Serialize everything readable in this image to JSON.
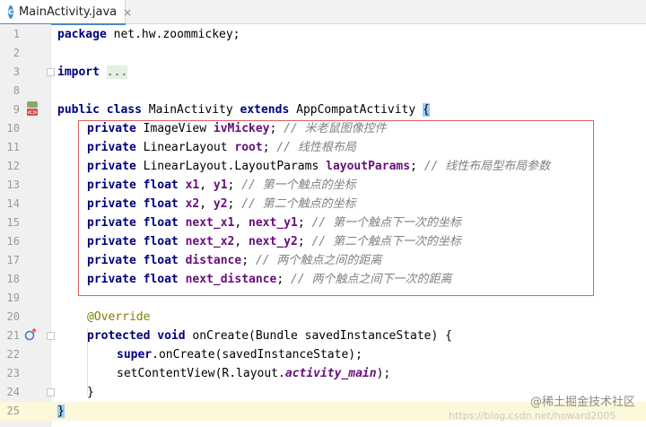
{
  "tab": {
    "icon_letter": "c",
    "label": "MainActivity.java",
    "close": "×"
  },
  "lines": [
    {
      "n": "1"
    },
    {
      "n": "2"
    },
    {
      "n": "3"
    },
    {
      "n": "8"
    },
    {
      "n": "9"
    },
    {
      "n": "10"
    },
    {
      "n": "11"
    },
    {
      "n": "12"
    },
    {
      "n": "13"
    },
    {
      "n": "14"
    },
    {
      "n": "15"
    },
    {
      "n": "16"
    },
    {
      "n": "17"
    },
    {
      "n": "18"
    },
    {
      "n": "19"
    },
    {
      "n": "20"
    },
    {
      "n": "21"
    },
    {
      "n": "22"
    },
    {
      "n": "23"
    },
    {
      "n": "24"
    },
    {
      "n": "25"
    }
  ],
  "code": {
    "l1_kw": "package",
    "l1_rest": " net.hw.zoommickey;",
    "l3_kw": "import",
    "l3_dots": "...",
    "l9_kw1": "public class",
    "l9_name": " MainActivity ",
    "l9_kw2": "extends",
    "l9_rest": " AppCompatActivity ",
    "l9_brace": "{",
    "l10_kw": "private",
    "l10_type": " ImageView ",
    "l10_field": "ivMickey",
    "l10_semi": "; ",
    "l10_cmt": "// 米老鼠图像控件",
    "l11_kw": "private",
    "l11_type": " LinearLayout ",
    "l11_field": "root",
    "l11_semi": "; ",
    "l11_cmt": "// 线性根布局",
    "l12_kw": "private",
    "l12_type": " LinearLayout.LayoutParams ",
    "l12_field": "layoutParams",
    "l12_semi": "; ",
    "l12_cmt": "// 线性布局型布局参数",
    "l13_kw": "private float",
    "l13_f1": " x1",
    "l13_c": ", ",
    "l13_f2": "y1",
    "l13_semi": "; ",
    "l13_cmt": "// 第一个触点的坐标",
    "l14_kw": "private float",
    "l14_f1": " x2",
    "l14_c": ", ",
    "l14_f2": "y2",
    "l14_semi": "; ",
    "l14_cmt": "// 第二个触点的坐标",
    "l15_kw": "private float",
    "l15_f1": " next_x1",
    "l15_c": ", ",
    "l15_f2": "next_y1",
    "l15_semi": "; ",
    "l15_cmt": "// 第一个触点下一次的坐标",
    "l16_kw": "private float",
    "l16_f1": " next_x2",
    "l16_c": ", ",
    "l16_f2": "next_y2",
    "l16_semi": "; ",
    "l16_cmt": "// 第二个触点下一次的坐标",
    "l17_kw": "private float",
    "l17_f1": " distance",
    "l17_semi": "; ",
    "l17_cmt": "// 两个触点之间的距离",
    "l18_kw": "private float",
    "l18_f1": " next_distance",
    "l18_semi": "; ",
    "l18_cmt": "// 两个触点之间下一次的距离",
    "l20_ann": "@Override",
    "l21_kw": "protected void",
    "l21_rest": " onCreate(Bundle savedInstanceState) {",
    "l22_kw": "super",
    "l22_rest": ".onCreate(savedInstanceState);",
    "l23_pre": "setContentView(R.layout.",
    "l23_field": "activity_main",
    "l23_post": ");",
    "l24": "}",
    "l25": "}"
  },
  "watermark": "@稀土掘金技术社区",
  "watermark_url": "https://blog.csdn.net/howard2005"
}
